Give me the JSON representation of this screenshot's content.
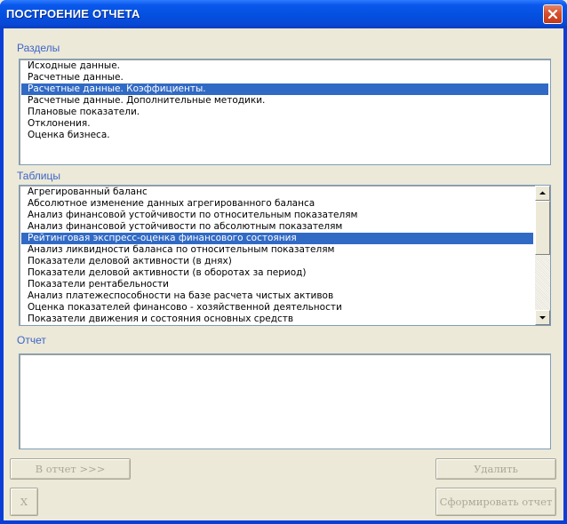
{
  "window": {
    "title": "ПОСТРОЕНИЕ ОТЧЕТА"
  },
  "sections": {
    "label": "Разделы",
    "items": [
      "Исходные данные.",
      "Расчетные данные.",
      "Расчетные данные. Коэффициенты.",
      "Расчетные данные. Дополнительные методики.",
      "Плановые показатели.",
      "Отклонения.",
      "Оценка бизнеса."
    ],
    "selected_index": 2
  },
  "tables": {
    "label": "Таблицы",
    "items": [
      "Агрегированный баланс",
      "Абсолютное изменение данных агрегированного баланса",
      "Анализ финансовой устойчивости по относительным показателям",
      "Анализ финансовой устойчивости по абсолютным показателям",
      "Рейтинговая экспресс-оценка финансового состояния",
      "Анализ ликвидности баланса по относительным показателям",
      "Показатели деловой активности (в днях)",
      "Показатели деловой активности (в оборотах за период)",
      "Показатели рентабельности",
      "Анализ платежеспособности на базе расчета чистых активов",
      "Оценка показателей финансово - хозяйственной деятельности",
      "Показатели движения и состояния основных средств"
    ],
    "selected_index": 4
  },
  "report": {
    "label": "Отчет",
    "items": []
  },
  "buttons": {
    "to_report": "В отчет >>>",
    "delete": "Удалить",
    "close_x": "X",
    "generate": "Сформировать отчет"
  },
  "icons": {
    "close": "close-icon",
    "scroll_up": "scroll-up-arrow-icon",
    "scroll_down": "scroll-down-arrow-icon"
  },
  "colors": {
    "titlebar": "#0451E1",
    "selection": "#316AC5",
    "label": "#3C64C8",
    "disabled_text": "#ACA899"
  }
}
